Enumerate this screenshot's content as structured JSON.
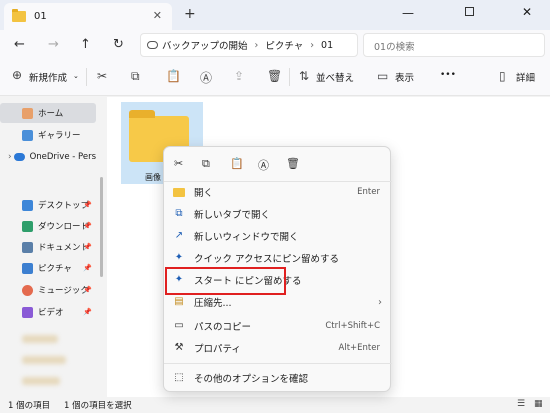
{
  "tab": {
    "title": "01",
    "close": "✕",
    "new_tab": "+"
  },
  "window": {
    "minimize": "—",
    "close": "✕"
  },
  "address": {
    "back": "←",
    "forward": "→",
    "up": "↑",
    "refresh": "↻",
    "crumbs": [
      "バックアップの開始",
      "ピクチャ",
      "01"
    ],
    "separator": "›",
    "search_placeholder": "01の検索"
  },
  "toolbar": {
    "new_label": "新規作成",
    "sort_label": "並べ替え",
    "view_label": "表示",
    "more_label": "•••",
    "details_label": "詳細"
  },
  "nav": {
    "items": [
      {
        "label": "ホーム"
      },
      {
        "label": "ギャラリー"
      },
      {
        "label": "OneDrive - Pers"
      },
      {
        "label": "デスクトップ"
      },
      {
        "label": "ダウンロード"
      },
      {
        "label": "ドキュメント"
      },
      {
        "label": "ピクチャ"
      },
      {
        "label": "ミュージック"
      },
      {
        "label": "ビデオ"
      }
    ],
    "pin": "📌",
    "expand": "›"
  },
  "content": {
    "folder_name": "画像"
  },
  "status": {
    "count": "1 個の項目",
    "selected": "1 個の項目を選択"
  },
  "context_menu": {
    "items": [
      {
        "label": "開く",
        "shortcut": "Enter",
        "icon": "folder-icon"
      },
      {
        "label": "新しいタブで開く",
        "shortcut": "",
        "icon": "new-tab-icon"
      },
      {
        "label": "新しいウィンドウで開く",
        "shortcut": "",
        "icon": "new-window-icon"
      },
      {
        "label": "クイック アクセスにピン留めする",
        "shortcut": "",
        "icon": "pin-icon"
      },
      {
        "label": "スタート にピン留めする",
        "shortcut": "",
        "icon": "pin-icon"
      },
      {
        "label": "圧縮先...",
        "shortcut": "",
        "icon": "zip-icon"
      },
      {
        "label": "パスのコピー",
        "shortcut": "Ctrl+Shift+C",
        "icon": "copy-path-icon"
      },
      {
        "label": "プロパティ",
        "shortcut": "Alt+Enter",
        "icon": "wrench-icon"
      },
      {
        "label": "その他のオプションを確認",
        "shortcut": "",
        "icon": "more-options-icon"
      }
    ],
    "submenu_arrow": "›"
  },
  "colors": {
    "accent": "#1f5fb5",
    "highlight_border": "#e02020",
    "selection": "#cce4f7"
  }
}
